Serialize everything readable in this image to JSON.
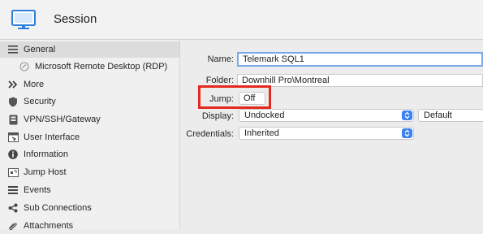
{
  "header": {
    "title": "Session",
    "icon": "monitor-icon",
    "accent": "#2f7fd8"
  },
  "sidebar": {
    "items": [
      {
        "label": "General",
        "icon": "list-icon",
        "selected": true
      },
      {
        "label": "Microsoft Remote Desktop (RDP)",
        "icon": "rdp-icon",
        "sub": true
      },
      {
        "label": "More",
        "icon": "chevron-double-right-icon"
      },
      {
        "label": "Security",
        "icon": "shield-icon"
      },
      {
        "label": "VPN/SSH/Gateway",
        "icon": "vpn-icon"
      },
      {
        "label": "User Interface",
        "icon": "window-icon"
      },
      {
        "label": "Information",
        "icon": "info-icon"
      },
      {
        "label": "Jump Host",
        "icon": "jump-host-icon"
      },
      {
        "label": "Events",
        "icon": "events-icon"
      },
      {
        "label": "Sub Connections",
        "icon": "share-icon"
      },
      {
        "label": "Attachments",
        "icon": "paperclip-icon"
      }
    ]
  },
  "form": {
    "name": {
      "label": "Name:",
      "value": "Telemark SQL1"
    },
    "folder": {
      "label": "Folder:",
      "value": "Downhill Pro\\Montreal"
    },
    "jump": {
      "label": "Jump:",
      "value": "Off"
    },
    "display": {
      "label": "Display:",
      "value": "Undocked",
      "secondary": "Default"
    },
    "credentials": {
      "label": "Credentials:",
      "value": "Inherited"
    }
  },
  "colors": {
    "highlight": "#e32a1e",
    "stepper": "#3b82f6",
    "focus": "#7ba7e8"
  }
}
